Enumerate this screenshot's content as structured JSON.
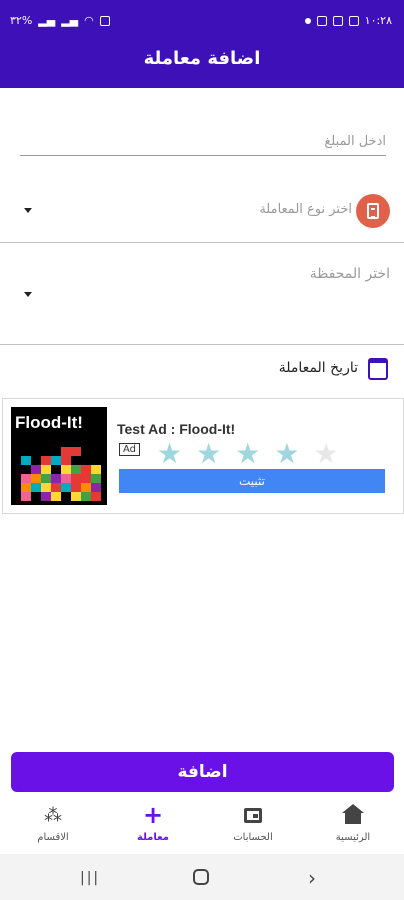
{
  "status_bar": {
    "time": "١٠:٢٨",
    "battery": "٣٢%"
  },
  "header": {
    "title": "اضافة معاملة"
  },
  "form": {
    "amount_placeholder": "ادخل المبلغ",
    "type_placeholder": "اختر نوع المعاملة",
    "wallet_placeholder": "اختر المحفظة",
    "date_label": "تاريخ المعاملة"
  },
  "ad": {
    "brand": "Flood-It!",
    "title": "Test Ad : Flood-It!",
    "tag": "Ad",
    "rating_stars": 4,
    "rating_max": 5,
    "install_label": "تثبيت"
  },
  "actions": {
    "add_label": "اضافة"
  },
  "bottom_nav": {
    "items": [
      {
        "label": "الرئيسية",
        "icon": "home-icon"
      },
      {
        "label": "الحسابات",
        "icon": "wallet-icon"
      },
      {
        "label": "معاملة",
        "icon": "plus-icon",
        "active": true
      },
      {
        "label": "الاقسام",
        "icon": "categories-icon"
      }
    ]
  },
  "colors": {
    "primary": "#3e10b8",
    "button": "#6a11e8",
    "type_badge": "#e0604a",
    "install": "#4285f4"
  }
}
